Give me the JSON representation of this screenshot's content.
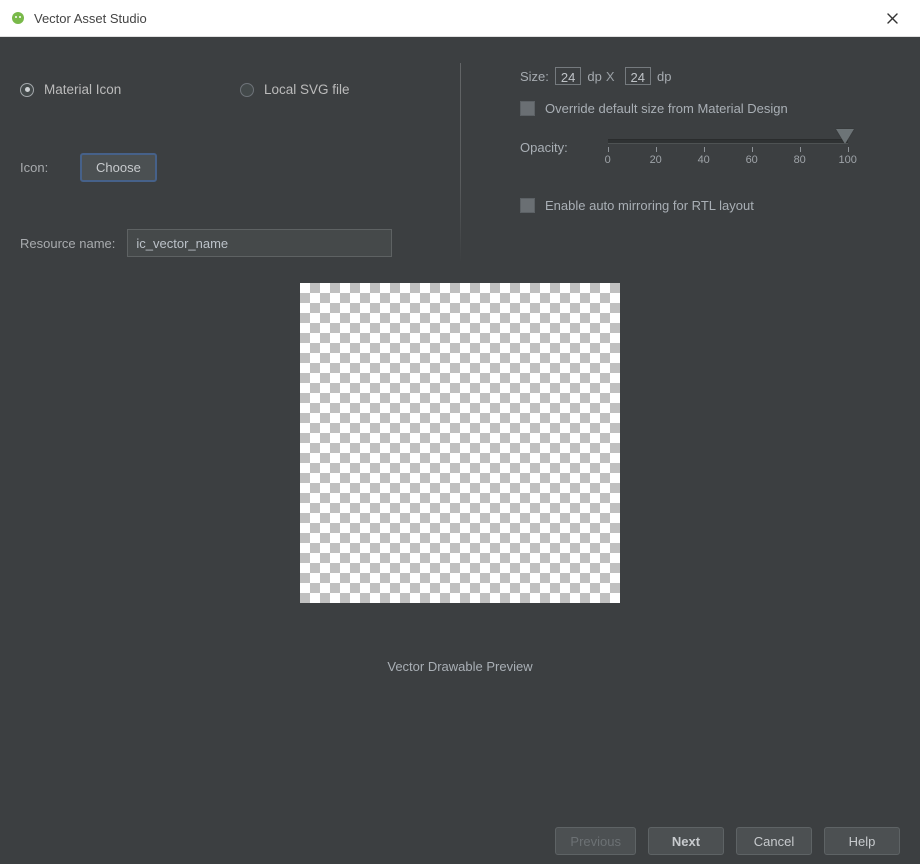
{
  "titlebar": {
    "title": "Vector Asset Studio"
  },
  "radios": {
    "material": {
      "label": "Material Icon",
      "selected": true
    },
    "localsvg": {
      "label": "Local SVG file",
      "selected": false
    }
  },
  "left": {
    "icon_label": "Icon:",
    "choose_label": "Choose",
    "resource_label": "Resource name:",
    "resource_value": "ic_vector_name"
  },
  "right": {
    "size_label": "Size:",
    "size_w": "24",
    "size_h": "24",
    "dp": "dp",
    "x_sep": "X",
    "override_label": "Override default size from Material Design",
    "opacity_label": "Opacity:",
    "opacity_value": 100,
    "opacity_ticks": [
      "0",
      "20",
      "40",
      "60",
      "80",
      "100"
    ],
    "rtl_label": "Enable auto mirroring for RTL layout"
  },
  "preview": {
    "caption": "Vector Drawable Preview"
  },
  "footer": {
    "previous": "Previous",
    "next": "Next",
    "cancel": "Cancel",
    "help": "Help"
  }
}
